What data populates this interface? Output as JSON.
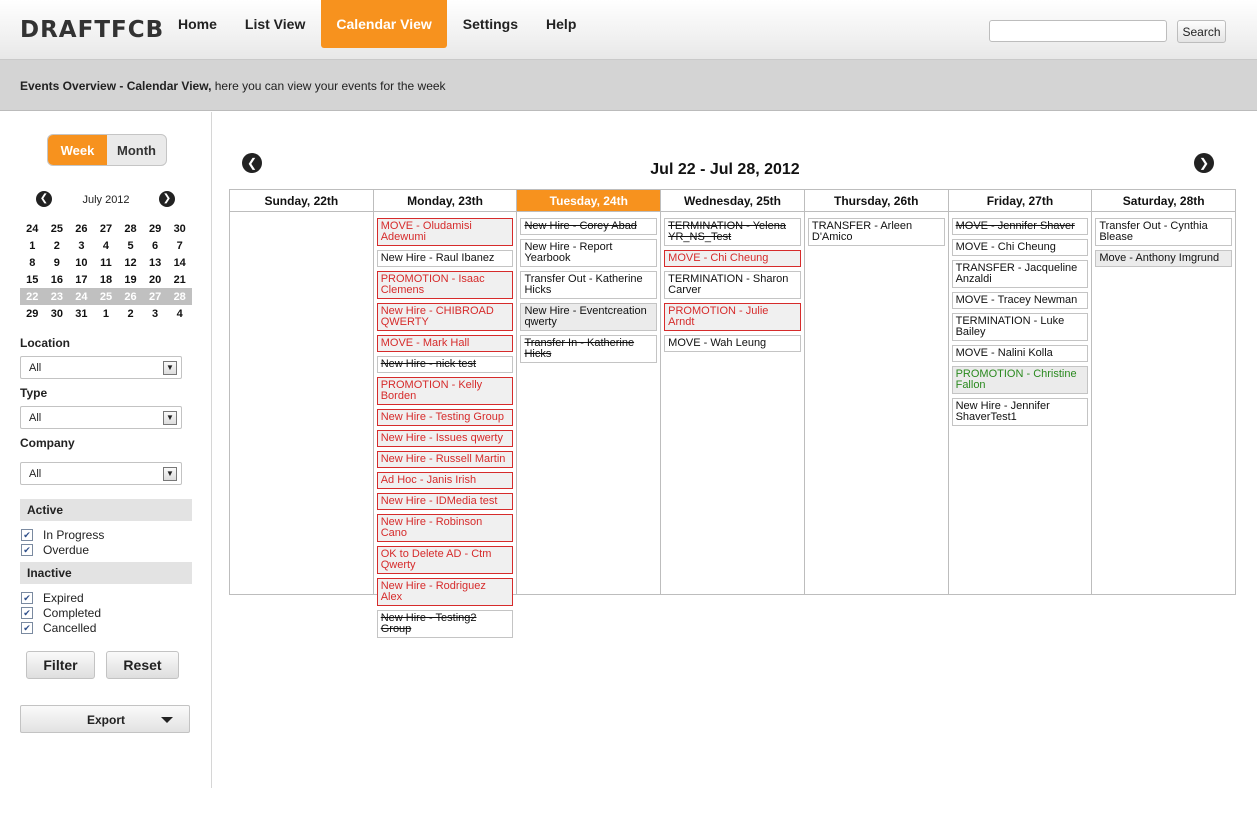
{
  "app": {
    "logo": "DRAFTFCB"
  },
  "nav": [
    {
      "label": "Home",
      "active": false
    },
    {
      "label": "List View",
      "active": false
    },
    {
      "label": "Calendar View",
      "active": true
    },
    {
      "label": "Settings",
      "active": false
    },
    {
      "label": "Help",
      "active": false
    }
  ],
  "search": {
    "placeholder": "",
    "button": "Search"
  },
  "subheader": {
    "bold": "Events Overview - Calendar View,",
    "rest": " here you can view your events for the week"
  },
  "sidebar": {
    "view_toggle": {
      "week": "Week",
      "month": "Month",
      "selected": "Week"
    },
    "mini_calendar": {
      "title": "July 2012",
      "prev_icon": "chevron-left-icon",
      "next_icon": "chevron-right-icon",
      "weeks": [
        [
          "24",
          "25",
          "26",
          "27",
          "28",
          "29",
          "30"
        ],
        [
          "1",
          "2",
          "3",
          "4",
          "5",
          "6",
          "7"
        ],
        [
          "8",
          "9",
          "10",
          "11",
          "12",
          "13",
          "14"
        ],
        [
          "15",
          "16",
          "17",
          "18",
          "19",
          "20",
          "21"
        ],
        [
          "22",
          "23",
          "24",
          "25",
          "26",
          "27",
          "28"
        ],
        [
          "29",
          "30",
          "31",
          "1",
          "2",
          "3",
          "4"
        ]
      ],
      "selected_week_index": 4
    },
    "location": {
      "label": "Location",
      "value": "All"
    },
    "type": {
      "label": "Type",
      "value": "All"
    },
    "company": {
      "label": "Company",
      "value": "All"
    },
    "active_section": {
      "label": "Active",
      "items": [
        {
          "label": "In Progress",
          "checked": true
        },
        {
          "label": "Overdue",
          "checked": true
        }
      ]
    },
    "inactive_section": {
      "label": "Inactive",
      "items": [
        {
          "label": "Expired",
          "checked": true
        },
        {
          "label": "Completed",
          "checked": true
        },
        {
          "label": "Cancelled",
          "checked": true
        }
      ]
    },
    "filter_button": "Filter",
    "reset_button": "Reset",
    "export_button": "Export"
  },
  "calendar": {
    "title": "Jul 22 - Jul 28, 2012",
    "prev_icon": "arrow-left-icon",
    "next_icon": "arrow-right-icon",
    "today_index": 2,
    "colors": {
      "accent": "#f7921e",
      "alert": "#d62b2b",
      "success": "#2b8a1f"
    },
    "days": [
      {
        "label": "Sunday, 22th",
        "events": []
      },
      {
        "label": "Monday, 23th",
        "events": [
          {
            "text": "MOVE - Oludamisi Adewumi",
            "style": "red"
          },
          {
            "text": "New Hire - Raul Ibanez",
            "style": "normal"
          },
          {
            "text": "PROMOTION - Isaac Clemens",
            "style": "red"
          },
          {
            "text": "New Hire - CHIBROAD QWERTY",
            "style": "red"
          },
          {
            "text": "MOVE - Mark Hall",
            "style": "red"
          },
          {
            "text": "New Hire - nick test",
            "style": "strike"
          },
          {
            "text": "PROMOTION - Kelly Borden",
            "style": "red"
          },
          {
            "text": "New Hire - Testing Group",
            "style": "red"
          },
          {
            "text": "New Hire - Issues qwerty",
            "style": "red"
          },
          {
            "text": "New Hire - Russell Martin",
            "style": "red"
          },
          {
            "text": "Ad Hoc - Janis Irish",
            "style": "red"
          },
          {
            "text": "New Hire - IDMedia test",
            "style": "red"
          },
          {
            "text": "New Hire - Robinson Cano",
            "style": "red"
          },
          {
            "text": "OK to Delete AD - Ctm Qwerty",
            "style": "red"
          },
          {
            "text": "New Hire - Rodriguez Alex",
            "style": "red"
          },
          {
            "text": "New Hire - Testing2 Group",
            "style": "strike"
          }
        ]
      },
      {
        "label": "Tuesday, 24th",
        "events": [
          {
            "text": "New Hire - Corey Abad",
            "style": "strike"
          },
          {
            "text": "New Hire - Report Yearbook",
            "style": "normal"
          },
          {
            "text": "Transfer Out - Katherine Hicks",
            "style": "normal"
          },
          {
            "text": "New Hire - Eventcreation qwerty",
            "style": "grey"
          },
          {
            "text": "Transfer In - Katherine Hicks",
            "style": "strike"
          }
        ]
      },
      {
        "label": "Wednesday, 25th",
        "events": [
          {
            "text": "TERMINATION - Yelena YR_NS_Test",
            "style": "strike"
          },
          {
            "text": "MOVE - Chi Cheung",
            "style": "red"
          },
          {
            "text": "TERMINATION - Sharon Carver",
            "style": "normal"
          },
          {
            "text": "PROMOTION - Julie Arndt",
            "style": "red"
          },
          {
            "text": "MOVE - Wah Leung",
            "style": "normal"
          }
        ]
      },
      {
        "label": "Thursday, 26th",
        "events": [
          {
            "text": "TRANSFER - Arleen D'Amico",
            "style": "normal"
          }
        ]
      },
      {
        "label": "Friday, 27th",
        "events": [
          {
            "text": "MOVE - Jennifer Shaver",
            "style": "strike"
          },
          {
            "text": "MOVE - Chi Cheung",
            "style": "normal"
          },
          {
            "text": "TRANSFER - Jacqueline Anzaldi",
            "style": "normal"
          },
          {
            "text": "MOVE - Tracey Newman",
            "style": "normal"
          },
          {
            "text": "TERMINATION - Luke Bailey",
            "style": "normal"
          },
          {
            "text": "MOVE - Nalini Kolla",
            "style": "normal"
          },
          {
            "text": "PROMOTION - Christine Fallon",
            "style": "green"
          },
          {
            "text": "New Hire - Jennifer ShaverTest1",
            "style": "normal"
          }
        ]
      },
      {
        "label": "Saturday, 28th",
        "events": [
          {
            "text": "Transfer Out - Cynthia Blease",
            "style": "normal"
          },
          {
            "text": "Move - Anthony Imgrund",
            "style": "grey"
          }
        ]
      }
    ]
  }
}
